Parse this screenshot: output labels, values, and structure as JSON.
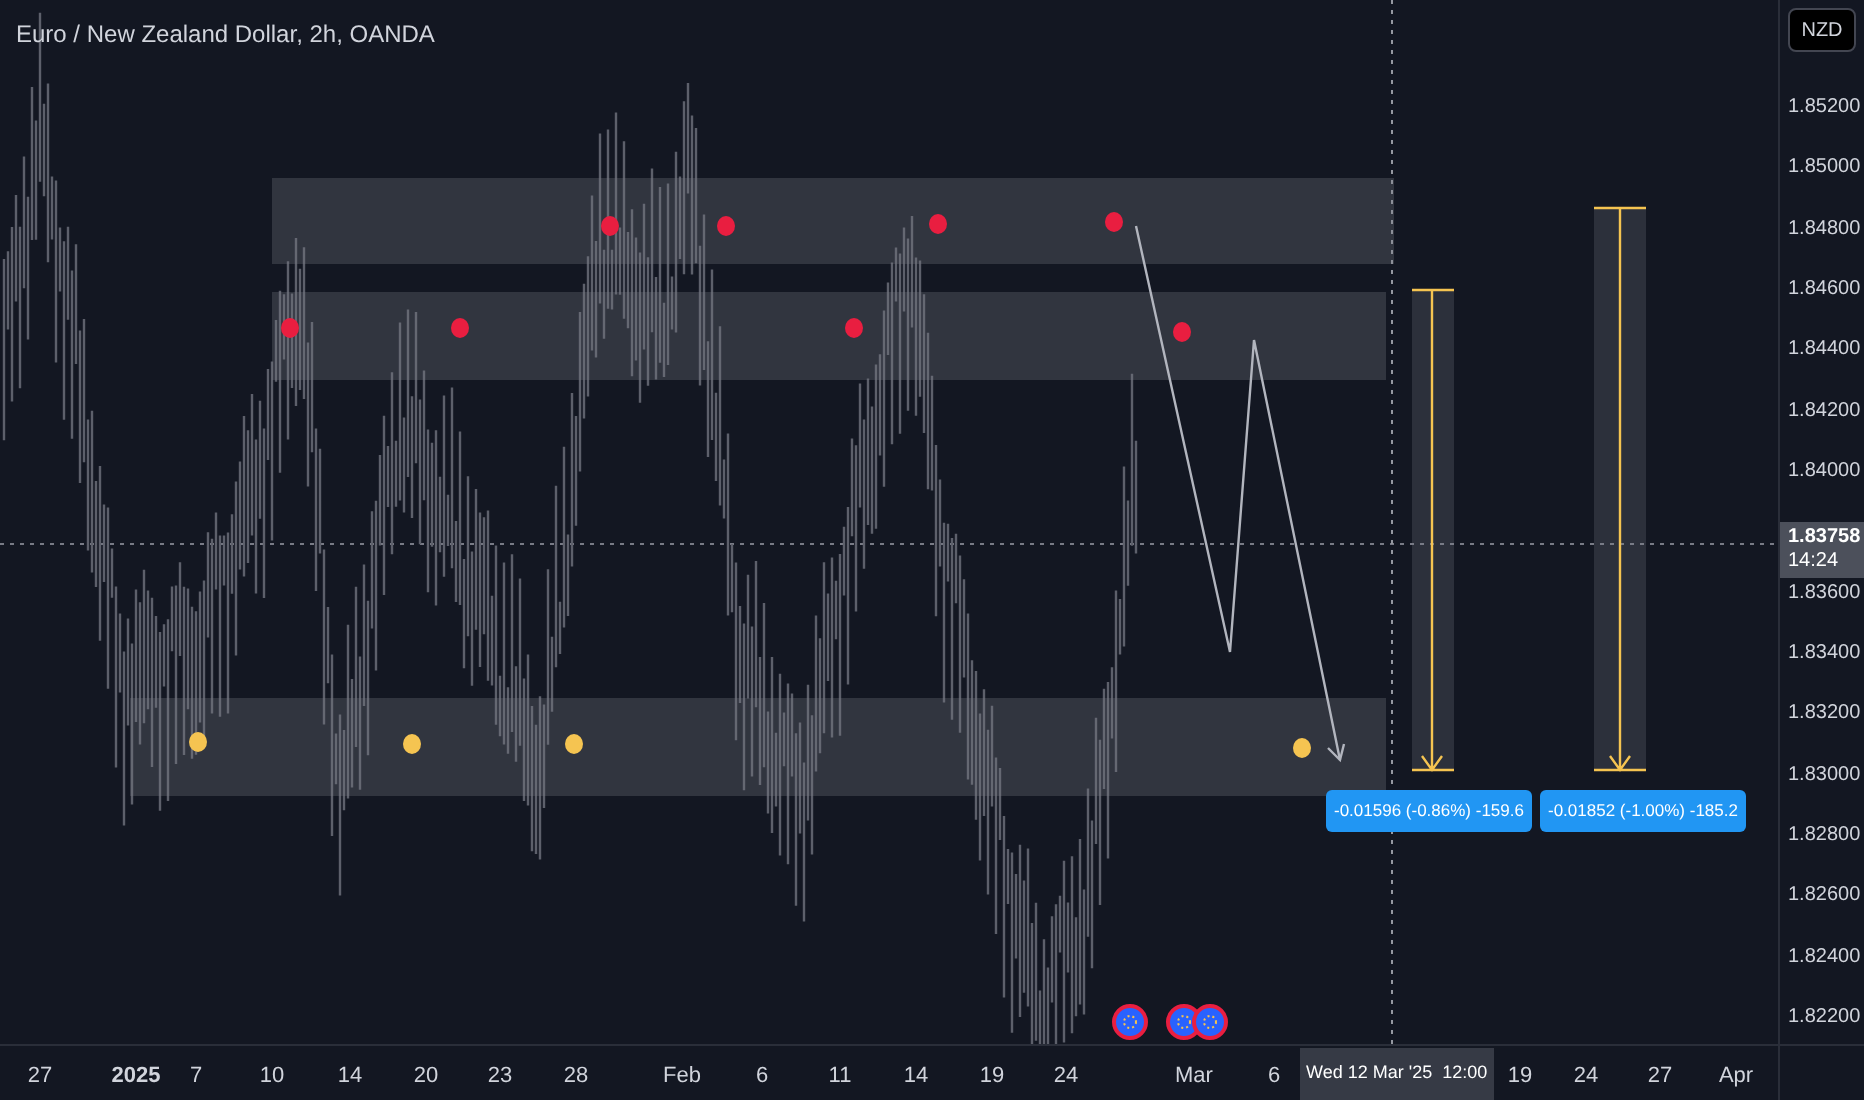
{
  "chart": {
    "title": "Euro / New Zealand Dollar, 2h, OANDA",
    "measurements": [
      {
        "label": "-0.01596 (-0.86%) -159.6"
      },
      {
        "label": "-0.01852 (-1.00%) -185.2"
      }
    ]
  },
  "price_axis": {
    "currency_button": "NZD",
    "prices": [
      "1.85200",
      "1.85000",
      "1.84800",
      "1.84600",
      "1.84400",
      "1.84200",
      "1.84000",
      "1.83600",
      "1.83400",
      "1.83200",
      "1.83000",
      "1.82800",
      "1.82600",
      "1.82400",
      "1.82200"
    ],
    "last_price": "1.83758",
    "countdown": "14:24"
  },
  "time_axis": {
    "ticks": [
      {
        "label": "27",
        "bold": false
      },
      {
        "label": "2025",
        "bold": true
      },
      {
        "label": "7",
        "bold": false
      },
      {
        "label": "10",
        "bold": false
      },
      {
        "label": "14",
        "bold": false
      },
      {
        "label": "20",
        "bold": false
      },
      {
        "label": "23",
        "bold": false
      },
      {
        "label": "28",
        "bold": false
      },
      {
        "label": "Feb",
        "bold": false
      },
      {
        "label": "6",
        "bold": false
      },
      {
        "label": "11",
        "bold": false
      },
      {
        "label": "14",
        "bold": false
      },
      {
        "label": "19",
        "bold": false
      },
      {
        "label": "24",
        "bold": false
      },
      {
        "label": "Mar",
        "bold": false
      },
      {
        "label": "6",
        "bold": false
      },
      {
        "label": "19",
        "bold": false
      },
      {
        "label": "24",
        "bold": false
      },
      {
        "label": "27",
        "bold": false
      },
      {
        "label": "Apr",
        "bold": false
      }
    ],
    "crosshair_date": "Wed 12 Mar '25",
    "crosshair_time": "12:00"
  }
}
